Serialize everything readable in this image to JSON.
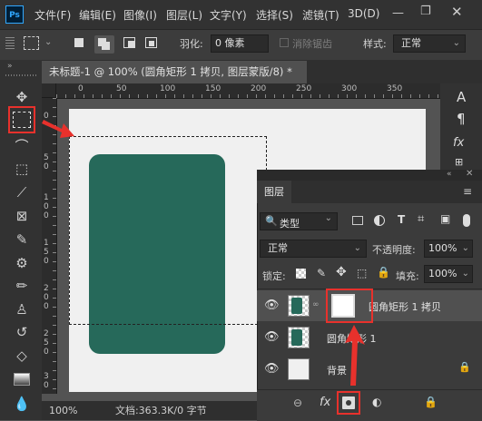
{
  "menubar": {
    "logo": "Ps",
    "items": [
      "文件(F)",
      "编辑(E)",
      "图像(I)",
      "图层(L)",
      "文字(Y)",
      "选择(S)",
      "滤镜(T)",
      "3D(D)"
    ]
  },
  "options": {
    "feather_label": "羽化:",
    "feather_value": "0 像素",
    "antialias_label": "消除锯齿",
    "style_label": "样式:",
    "style_value": "正常"
  },
  "document": {
    "tab_title": "未标题-1 @ 100% (圆角矩形 1 拷贝, 图层蒙版/8) *",
    "close_glyph": "×",
    "ruler_top": [
      "0",
      "50",
      "100",
      "150",
      "200",
      "250",
      "300",
      "350"
    ],
    "ruler_left": [
      "0",
      "5",
      "0",
      "1",
      "0",
      "0",
      "1",
      "5",
      "0",
      "2",
      "0",
      "0",
      "2",
      "5",
      "0",
      "3",
      "0",
      "0"
    ],
    "zoom": "100%",
    "doc_info": "文档:363.3K/0 字节"
  },
  "layers_panel": {
    "tab_label": "图层",
    "filter_label": "类型",
    "blend_mode": "正常",
    "opacity_label": "不透明度:",
    "opacity_value": "100%",
    "lock_label": "锁定:",
    "fill_label": "填充:",
    "fill_value": "100%",
    "layers": [
      {
        "name": "圆角矩形 1 拷贝",
        "selected": true
      },
      {
        "name": "圆角矩形 1",
        "selected": false
      },
      {
        "name": "背景",
        "selected": false
      }
    ],
    "footer_icons": [
      "link-icon",
      "fx-icon",
      "add-mask-icon",
      "adjustment-icon",
      "group-icon",
      "lock-icon"
    ]
  },
  "colors": {
    "shape_fill": "#26695a",
    "highlight_red": "#e8312c",
    "canvas_bg": "#f0f0f0"
  }
}
